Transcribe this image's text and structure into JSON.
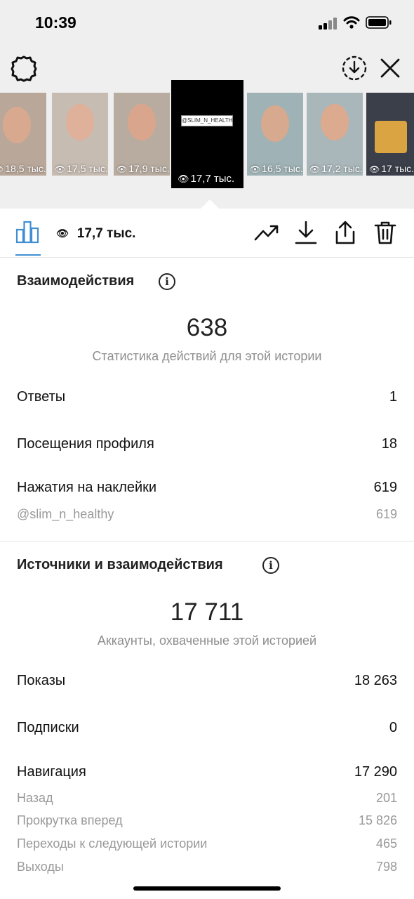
{
  "status_bar": {
    "time": "10:39"
  },
  "thumbnails": [
    {
      "views": "18,5 тыс."
    },
    {
      "views": "17,5 тыс."
    },
    {
      "views": "17,9 тыс."
    },
    {
      "views": "17,7 тыс.",
      "sticker": "@SLIM_N_HEALTHY",
      "active": true
    },
    {
      "views": "16,5 тыс."
    },
    {
      "views": "17,2 тыс."
    },
    {
      "views": "17 тыс."
    }
  ],
  "toolbar": {
    "view_count": "17,7 тыс."
  },
  "interactions": {
    "title": "Взаимодействия",
    "total": "638",
    "caption": "Статистика действий для этой истории",
    "rows": [
      {
        "label": "Ответы",
        "value": "1"
      },
      {
        "label": "Посещения профиля",
        "value": "18"
      },
      {
        "label": "Нажатия на наклейки",
        "value": "619"
      }
    ],
    "sub_rows": [
      {
        "label": "@slim_n_healthy",
        "value": "619"
      }
    ]
  },
  "discovery": {
    "title": "Источники и взаимодействия",
    "total": "17 711",
    "caption": "Аккаунты, охваченные этой историей",
    "rows": [
      {
        "label": "Показы",
        "value": "18 263"
      },
      {
        "label": "Подписки",
        "value": "0"
      },
      {
        "label": "Навигация",
        "value": "17 290"
      }
    ],
    "sub_rows": [
      {
        "label": "Назад",
        "value": "201"
      },
      {
        "label": "Прокрутка вперед",
        "value": "15 826"
      },
      {
        "label": "Переходы к следующей истории",
        "value": "465"
      },
      {
        "label": "Выходы",
        "value": "798"
      }
    ]
  },
  "colors": {
    "accent": "#3f8fd2",
    "header_bg": "#efefef",
    "muted": "#8e8e8e"
  },
  "icons": [
    "settings-icon",
    "download-circle-icon",
    "close-icon",
    "bar-chart-icon",
    "eye-icon",
    "trending-icon",
    "download-icon",
    "share-icon",
    "trash-icon",
    "info-icon"
  ]
}
